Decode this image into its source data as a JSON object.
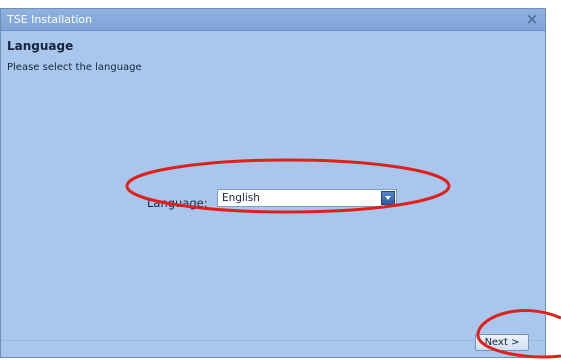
{
  "window": {
    "title": "TSE Installation",
    "close_label": "×"
  },
  "page": {
    "heading": "Language",
    "subheading": "Please select the language"
  },
  "language_field": {
    "label": "Language:",
    "selected": "English"
  },
  "footer": {
    "next_label": "Next >"
  },
  "colors": {
    "window_bg": "#a9c7ec",
    "titlebar": "#7ea3d6",
    "annotation_red": "#e0201c"
  },
  "annotations": [
    {
      "target": "language-select-area",
      "shape": "ellipse"
    },
    {
      "target": "next-button-area",
      "shape": "partial-ellipse"
    }
  ]
}
